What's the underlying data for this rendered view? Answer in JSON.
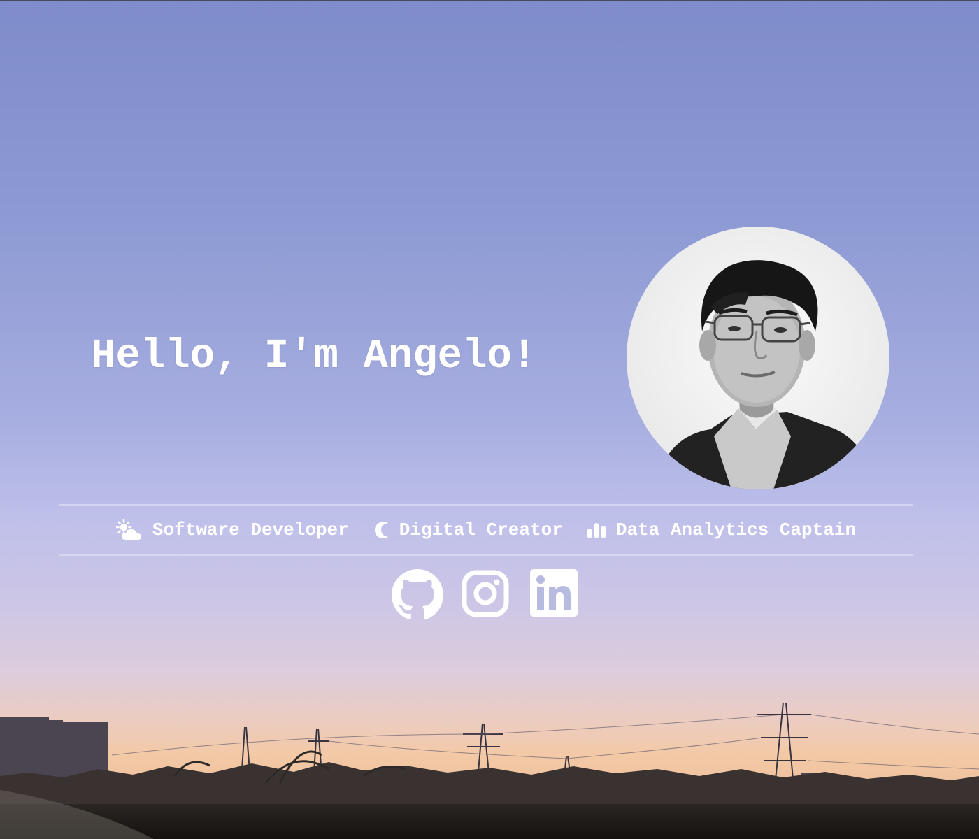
{
  "hero": {
    "greeting": "Hello, I'm Angelo!",
    "avatar": {
      "alt": "Angelo"
    }
  },
  "roles": [
    {
      "label": "Software Developer",
      "icon": "cloud-sun-icon"
    },
    {
      "label": "Digital Creator",
      "icon": "moon-icon"
    },
    {
      "label": "Data Analytics Captain",
      "icon": "bar-chart-icon"
    }
  ],
  "social": [
    {
      "label": "GitHub",
      "icon": "github-icon"
    },
    {
      "label": "Instagram",
      "icon": "instagram-icon"
    },
    {
      "label": "LinkedIn",
      "icon": "linkedin-icon"
    }
  ],
  "colors": {
    "text": "#ffffff",
    "sky_top": "#8896cf",
    "sky_mid": "#b3b6e6",
    "horizon": "#f0c7a4"
  }
}
